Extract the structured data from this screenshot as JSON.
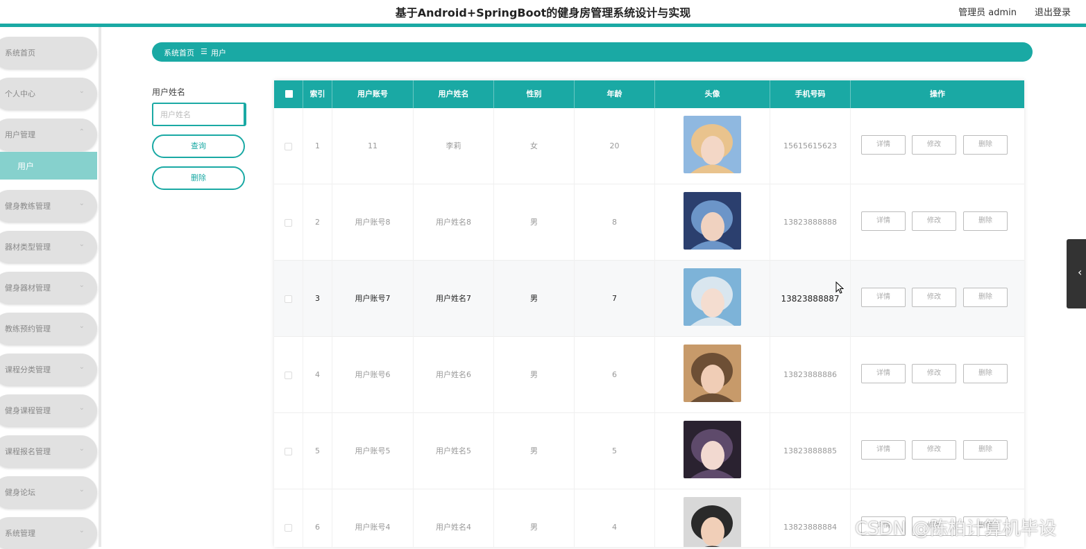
{
  "header": {
    "title": "基于Android+SpringBoot的健身房管理系统设计与实现",
    "admin": "管理员 admin",
    "logout": "退出登录"
  },
  "sidebar": {
    "items": [
      {
        "label": "系统首页",
        "chevron": ""
      },
      {
        "label": "个人中心",
        "chevron": "⌄"
      },
      {
        "label": "用户管理",
        "chevron": "⌃"
      },
      {
        "label": "健身教练管理",
        "chevron": "⌄"
      },
      {
        "label": "器材类型管理",
        "chevron": "⌄"
      },
      {
        "label": "健身器材管理",
        "chevron": "⌄"
      },
      {
        "label": "教练预约管理",
        "chevron": "⌄"
      },
      {
        "label": "课程分类管理",
        "chevron": "⌄"
      },
      {
        "label": "健身课程管理",
        "chevron": "⌄"
      },
      {
        "label": "课程报名管理",
        "chevron": "⌄"
      },
      {
        "label": "健身论坛",
        "chevron": "⌄"
      },
      {
        "label": "系统管理",
        "chevron": "⌄"
      }
    ],
    "sub_item": "用户"
  },
  "breadcrumb": {
    "home": "系统首页",
    "separator": "☰",
    "current": "用户"
  },
  "search": {
    "label": "用户姓名",
    "placeholder": "用户姓名",
    "query_button": "查询",
    "delete_button": "删除"
  },
  "table": {
    "headers": [
      "索引",
      "用户账号",
      "用户姓名",
      "性别",
      "年龄",
      "头像",
      "手机号码",
      "操作"
    ],
    "actions": {
      "detail": "详情",
      "edit": "修改",
      "delete": "删除"
    },
    "rows": [
      {
        "index": "1",
        "account": "11",
        "name": "李莉",
        "gender": "女",
        "age": "20",
        "phone": "15615615623",
        "avatar": "avatar-1"
      },
      {
        "index": "2",
        "account": "用户账号8",
        "name": "用户姓名8",
        "gender": "男",
        "age": "8",
        "phone": "13823888888",
        "avatar": "avatar-2"
      },
      {
        "index": "3",
        "account": "用户账号7",
        "name": "用户姓名7",
        "gender": "男",
        "age": "7",
        "phone": "13823888887",
        "avatar": "avatar-3"
      },
      {
        "index": "4",
        "account": "用户账号6",
        "name": "用户姓名6",
        "gender": "男",
        "age": "6",
        "phone": "13823888886",
        "avatar": "avatar-4"
      },
      {
        "index": "5",
        "account": "用户账号5",
        "name": "用户姓名5",
        "gender": "男",
        "age": "5",
        "phone": "13823888885",
        "avatar": "avatar-5"
      },
      {
        "index": "6",
        "account": "用户账号4",
        "name": "用户姓名4",
        "gender": "男",
        "age": "4",
        "phone": "13823888884",
        "avatar": "avatar-6"
      }
    ]
  },
  "watermark": "CSDN @陈柏计算机毕设",
  "colors": {
    "accent": "#1aa9a4",
    "accent_light": "#86d1cd"
  }
}
